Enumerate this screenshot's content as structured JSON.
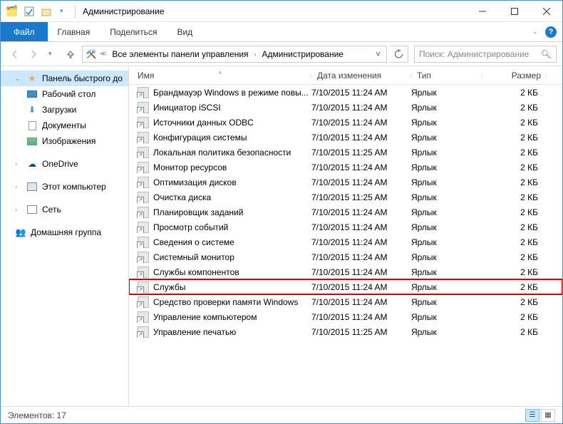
{
  "window": {
    "title": "Администрирование"
  },
  "ribbon": {
    "file": "Файл",
    "tabs": [
      "Главная",
      "Поделиться",
      "Вид"
    ]
  },
  "breadcrumb": {
    "items": [
      "Все элементы панели управления",
      "Администрирование"
    ]
  },
  "search": {
    "placeholder": "Поиск: Администрирование"
  },
  "sidebar": {
    "quick_access": "Панель быстрого до",
    "desktop": "Рабочий стол",
    "downloads": "Загрузки",
    "documents": "Документы",
    "pictures": "Изображения",
    "onedrive": "OneDrive",
    "this_pc": "Этот компьютер",
    "network": "Сеть",
    "homegroup": "Домашняя группа"
  },
  "columns": {
    "name": "Имя",
    "date": "Дата изменения",
    "type": "Тип",
    "size": "Размер"
  },
  "items": [
    {
      "name": "Брандмауэр Windows в режиме повы...",
      "date": "7/10/2015 11:24 AM",
      "type": "Ярлык",
      "size": "2 КБ",
      "hl": false
    },
    {
      "name": "Инициатор iSCSI",
      "date": "7/10/2015 11:24 AM",
      "type": "Ярлык",
      "size": "2 КБ",
      "hl": false
    },
    {
      "name": "Источники данных ODBC",
      "date": "7/10/2015 11:24 AM",
      "type": "Ярлык",
      "size": "2 КБ",
      "hl": false
    },
    {
      "name": "Конфигурация системы",
      "date": "7/10/2015 11:24 AM",
      "type": "Ярлык",
      "size": "2 КБ",
      "hl": false
    },
    {
      "name": "Локальная политика безопасности",
      "date": "7/10/2015 11:25 AM",
      "type": "Ярлык",
      "size": "2 КБ",
      "hl": false
    },
    {
      "name": "Монитор ресурсов",
      "date": "7/10/2015 11:24 AM",
      "type": "Ярлык",
      "size": "2 КБ",
      "hl": false
    },
    {
      "name": "Оптимизация дисков",
      "date": "7/10/2015 11:24 AM",
      "type": "Ярлык",
      "size": "2 КБ",
      "hl": false
    },
    {
      "name": "Очистка диска",
      "date": "7/10/2015 11:25 AM",
      "type": "Ярлык",
      "size": "2 КБ",
      "hl": false
    },
    {
      "name": "Планировщик заданий",
      "date": "7/10/2015 11:24 AM",
      "type": "Ярлык",
      "size": "2 КБ",
      "hl": false
    },
    {
      "name": "Просмотр событий",
      "date": "7/10/2015 11:24 AM",
      "type": "Ярлык",
      "size": "2 КБ",
      "hl": false
    },
    {
      "name": "Сведения о системе",
      "date": "7/10/2015 11:24 AM",
      "type": "Ярлык",
      "size": "2 КБ",
      "hl": false
    },
    {
      "name": "Системный монитор",
      "date": "7/10/2015 11:24 AM",
      "type": "Ярлык",
      "size": "2 КБ",
      "hl": false
    },
    {
      "name": "Службы компонентов",
      "date": "7/10/2015 11:24 AM",
      "type": "Ярлык",
      "size": "2 КБ",
      "hl": false
    },
    {
      "name": "Службы",
      "date": "7/10/2015 11:24 AM",
      "type": "Ярлык",
      "size": "2 КБ",
      "hl": true
    },
    {
      "name": "Средство проверки памяти Windows",
      "date": "7/10/2015 11:24 AM",
      "type": "Ярлык",
      "size": "2 КБ",
      "hl": false
    },
    {
      "name": "Управление компьютером",
      "date": "7/10/2015 11:24 AM",
      "type": "Ярлык",
      "size": "2 КБ",
      "hl": false
    },
    {
      "name": "Управление печатью",
      "date": "7/10/2015 11:25 AM",
      "type": "Ярлык",
      "size": "2 КБ",
      "hl": false
    }
  ],
  "status": {
    "count_label": "Элементов: 17"
  }
}
